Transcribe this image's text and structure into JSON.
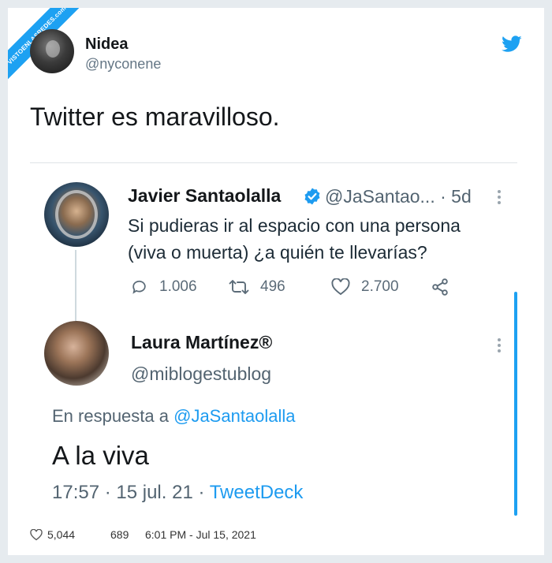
{
  "watermark": {
    "text": "VISTOENLASREDES",
    "suffix": ".com"
  },
  "tweet": {
    "author_name": "Nidea",
    "author_handle": "@nyconene",
    "text": "Twitter es maravilloso.",
    "likes": "5,044",
    "retweets": "689",
    "timestamp": "6:01 PM - Jul 15, 2021"
  },
  "embedded": {
    "original": {
      "author_name": "Javier Santaolalla",
      "author_handle": "@JaSantao...",
      "age": "5d",
      "text": "Si pudieras ir al espacio con una persona (viva o muerta) ¿a quién te llevarías?",
      "replies": "1.006",
      "retweets": "496",
      "likes": "2.700"
    },
    "reply": {
      "author_name": "Laura Martínez®",
      "author_handle": "@miblogestublog",
      "reply_prefix": "En respuesta a",
      "reply_mention": "@JaSantaolalla",
      "text": "A la viva",
      "time": "17:57",
      "date": "15 jul. 21",
      "source": "TweetDeck"
    }
  },
  "colors": {
    "brand_blue": "#1da1f2",
    "muted_text": "#536471",
    "background": "#e6ebef"
  },
  "icons": [
    "twitter-bird-icon",
    "verified-badge-icon",
    "reply-icon",
    "retweet-icon",
    "like-icon",
    "share-icon",
    "more-options-icon",
    "heart-icon"
  ]
}
